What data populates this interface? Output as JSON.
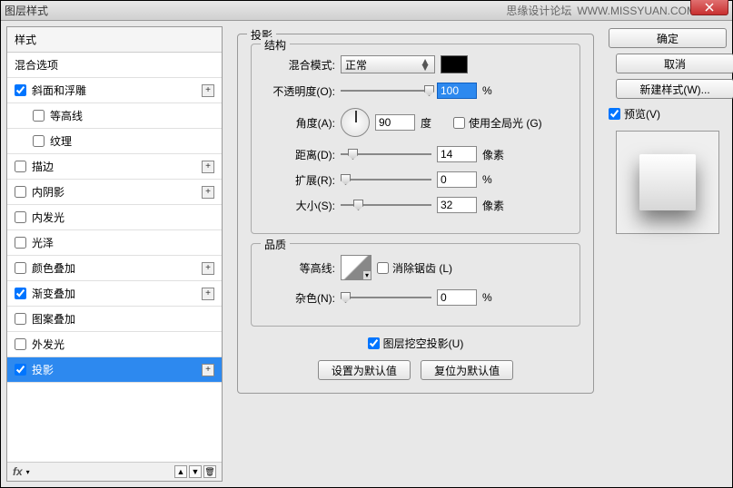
{
  "window": {
    "title": "图层样式",
    "watermark_text": "思缘设计论坛",
    "watermark_url": "WWW.MISSYUAN.COM"
  },
  "styles": {
    "header": "样式",
    "blending_options": "混合选项",
    "items": [
      {
        "label": "斜面和浮雕",
        "checked": true,
        "expandable": true
      },
      {
        "label": "等高线",
        "checked": false,
        "sub": true
      },
      {
        "label": "纹理",
        "checked": false,
        "sub": true
      },
      {
        "label": "描边",
        "checked": false,
        "expandable": true
      },
      {
        "label": "内阴影",
        "checked": false,
        "expandable": true
      },
      {
        "label": "内发光",
        "checked": false
      },
      {
        "label": "光泽",
        "checked": false
      },
      {
        "label": "颜色叠加",
        "checked": false,
        "expandable": true
      },
      {
        "label": "渐变叠加",
        "checked": true,
        "expandable": true
      },
      {
        "label": "图案叠加",
        "checked": false
      },
      {
        "label": "外发光",
        "checked": false
      },
      {
        "label": "投影",
        "checked": true,
        "expandable": true,
        "selected": true
      }
    ],
    "footer_fx": "fx"
  },
  "drop_shadow": {
    "title": "投影",
    "structure": {
      "title": "结构",
      "blend_mode_label": "混合模式:",
      "blend_mode_value": "正常",
      "opacity_label": "不透明度(O):",
      "opacity_value": "100",
      "opacity_unit": "%",
      "angle_label": "角度(A):",
      "angle_value": "90",
      "angle_unit": "度",
      "use_global_label": "使用全局光 (G)",
      "use_global_checked": false,
      "distance_label": "距离(D):",
      "distance_value": "14",
      "distance_unit": "像素",
      "spread_label": "扩展(R):",
      "spread_value": "0",
      "spread_unit": "%",
      "size_label": "大小(S):",
      "size_value": "32",
      "size_unit": "像素"
    },
    "quality": {
      "title": "品质",
      "contour_label": "等高线:",
      "antialias_label": "消除锯齿 (L)",
      "antialias_checked": false,
      "noise_label": "杂色(N):",
      "noise_value": "0",
      "noise_unit": "%"
    },
    "knockout_label": "图层挖空投影(U)",
    "knockout_checked": true,
    "reset_default": "设置为默认值",
    "restore_default": "复位为默认值"
  },
  "buttons": {
    "ok": "确定",
    "cancel": "取消",
    "new_style": "新建样式(W)...",
    "preview": "预览(V)",
    "preview_checked": true
  }
}
